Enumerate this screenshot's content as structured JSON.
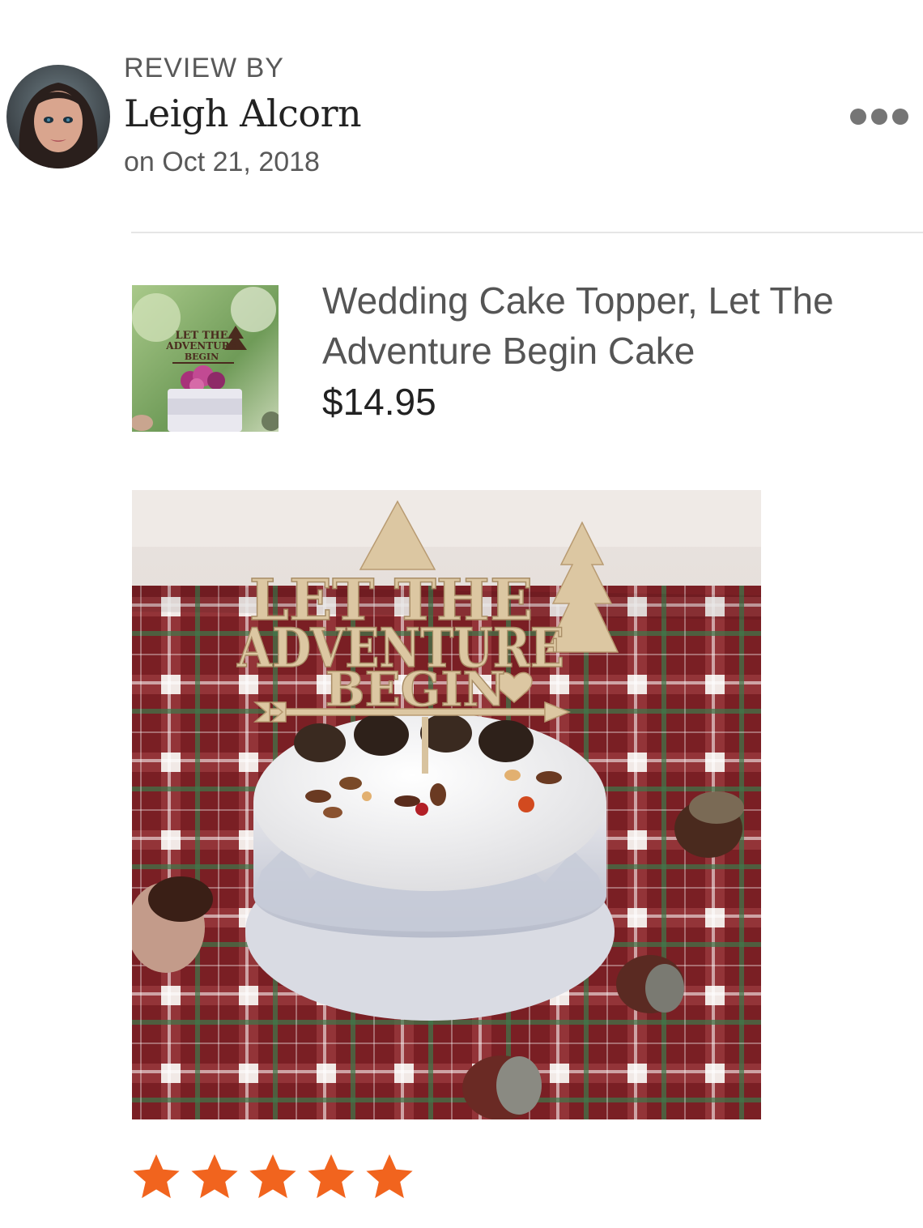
{
  "review": {
    "label": "REVIEW BY",
    "reviewer_name": "Leigh Alcorn",
    "date": "on Oct 21, 2018",
    "more_icon": "more-horizontal-icon"
  },
  "product": {
    "title": "Wedding Cake Topper, Let The Adventure Begin Cake",
    "price": "$14.95",
    "thumbnail_topper_text": [
      "LET THE",
      "ADVENTURE",
      "BEGIN"
    ]
  },
  "photo": {
    "topper_text": [
      "LET THE",
      "ADVENTURE",
      "BEGIN"
    ]
  },
  "rating": {
    "stars": 5,
    "max": 5,
    "star_color": "#f1641e"
  }
}
